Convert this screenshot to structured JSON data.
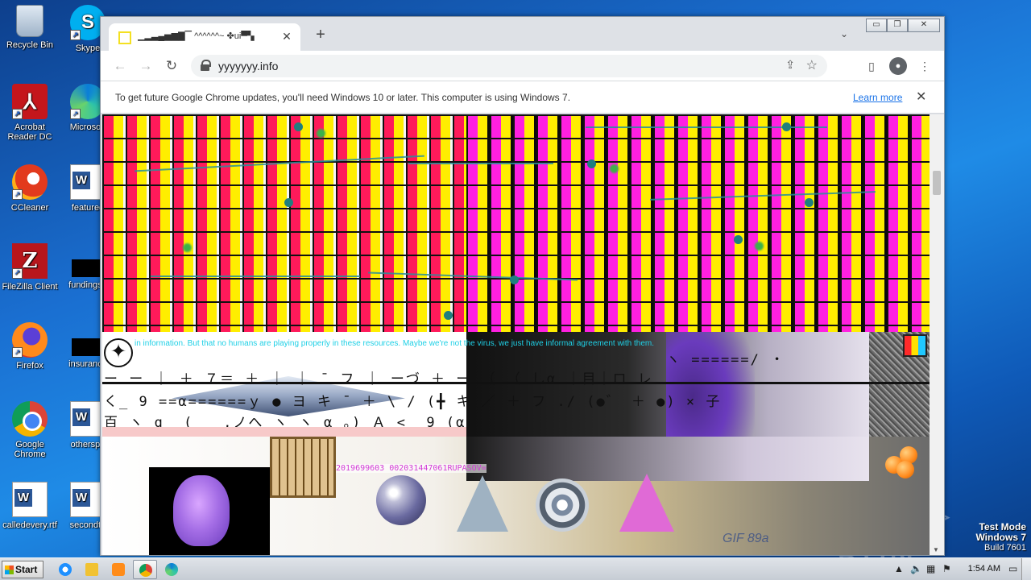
{
  "desktop": {
    "icons": [
      {
        "label": "Recycle Bin",
        "icon": "recycle-bin-icon"
      },
      {
        "label": "Skype",
        "icon": "skype-icon"
      },
      {
        "label": "Acrobat Reader DC",
        "icon": "acrobat-icon"
      },
      {
        "label": "Microsoft",
        "icon": "edge-icon"
      },
      {
        "label": "CCleaner",
        "icon": "ccleaner-icon"
      },
      {
        "label": "featured",
        "icon": "word-doc-icon"
      },
      {
        "label": "FileZilla Client",
        "icon": "filezilla-icon"
      },
      {
        "label": "fundingse",
        "icon": "black-file-icon"
      },
      {
        "label": "Firefox",
        "icon": "firefox-icon"
      },
      {
        "label": "insurance",
        "icon": "black-file-icon"
      },
      {
        "label": "Google Chrome",
        "icon": "chrome-icon"
      },
      {
        "label": "otherspo",
        "icon": "word-doc-icon"
      },
      {
        "label": "calledevery.rtf",
        "icon": "word-doc-icon"
      },
      {
        "label": "secondto",
        "icon": "word-doc-icon"
      }
    ]
  },
  "browser": {
    "tab_title": "▁▂▃▄▅▆▇▔ ^^^^^^~ ✤ui▀▚",
    "tab_close": "✕",
    "new_tab": "+",
    "url": "yyyyyyy.info",
    "infobar_message": "To get future Google Chrome updates, you'll need Windows 10 or later. This computer is using Windows 7.",
    "infobar_link": "Learn more",
    "infobar_close": "✕",
    "window_buttons": {
      "minimize": "▭",
      "restore": "❐",
      "close": "✕"
    }
  },
  "page": {
    "ticker_text": "in information. But that no humans are playing properly in these resources. Maybe we're not the virus, we just have informal agreement with them.",
    "kata_line1": "ー ー ｜ ＋  ７＝    ＋  ｜    ｜  ¯ フ  ｜   ーづ   ＋ ー       （    （ しα ｜目｜ロ  レ",
    "kata_line2": "く_    9  ==α======ｙ ● ヨ    キ   ¯ ＋ \\ /   (╋  キ  ／ ＋   フ ./  (●゛  ＋  ●)   ×     子",
    "kata_line3": "百  ヽ   q_      (__  ,ノへ   ヽ    ヽ   α    。)  Ａ    <_     9     (α",
    "kata_line4": "ヽ ======/    ・",
    "serial": "2019699603  002031447061RUPASOV=",
    "gif_text": "GIF 89a"
  },
  "watermark": {
    "brand": "ANY ▷ RUN",
    "test_mode": "Test Mode",
    "os": "Windows 7",
    "build": "Build 7601"
  },
  "taskbar": {
    "start_label": "Start",
    "clock": "1:54 AM"
  }
}
